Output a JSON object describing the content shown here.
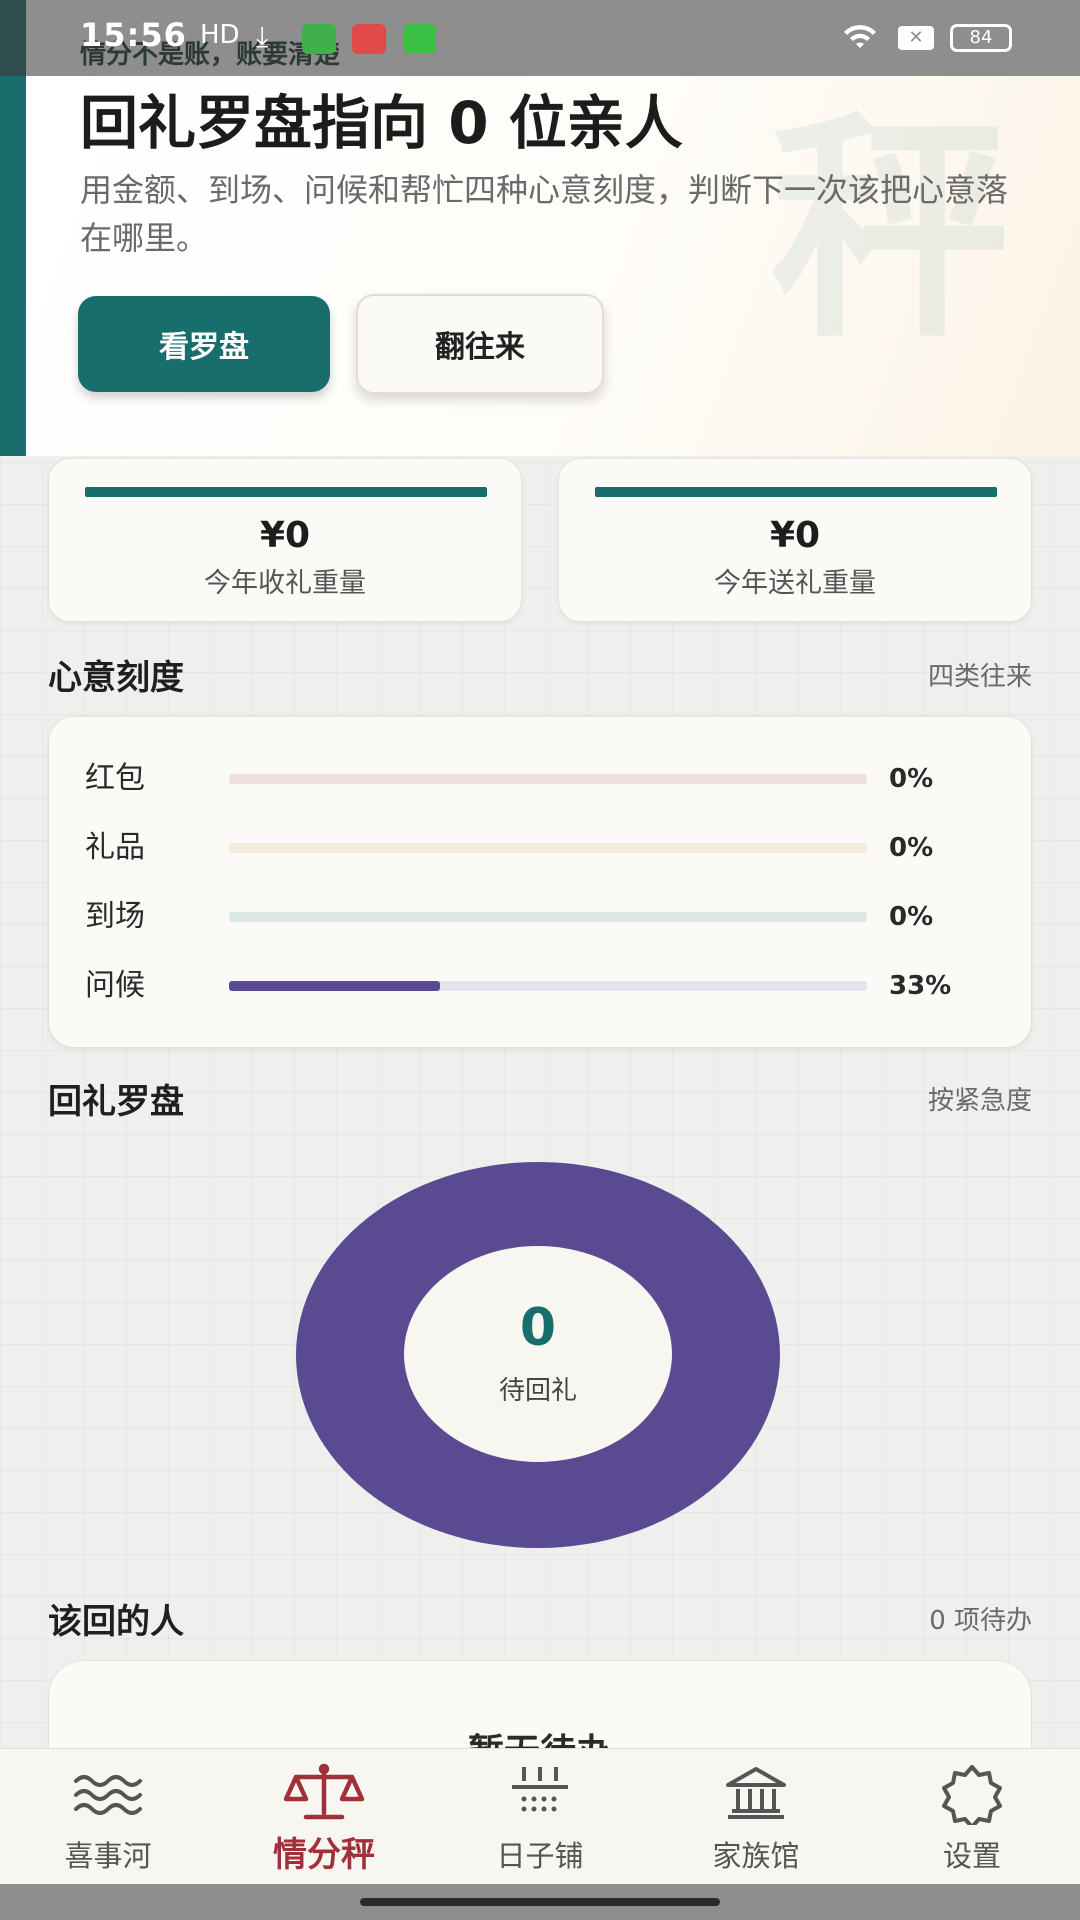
{
  "status_bar": {
    "time": "15:56",
    "behind_text": "情分不是账，账要清楚",
    "battery": "84"
  },
  "hero": {
    "watermark": "秤",
    "title": "回礼罗盘指向 0 位亲人",
    "subtitle": "用金额、到场、问候和帮忙四种心意刻度，判断下一次该把心意落在哪里。",
    "primary_button": "看罗盘",
    "secondary_button": "翻往来"
  },
  "stats": [
    {
      "value": "¥0",
      "label": "今年收礼重量"
    },
    {
      "value": "¥0",
      "label": "今年送礼重量"
    }
  ],
  "scale_section": {
    "title": "心意刻度",
    "note": "四类往来",
    "rows": [
      {
        "label": "红包",
        "pct_text": "0%",
        "fraction": 0.0,
        "track_color": "#efdfe1",
        "fill_color": "#c9707e"
      },
      {
        "label": "礼品",
        "pct_text": "0%",
        "fraction": 0.0,
        "track_color": "#f3ecdc",
        "fill_color": "#d9b46a"
      },
      {
        "label": "到场",
        "pct_text": "0%",
        "fraction": 0.0,
        "track_color": "#dde7e3",
        "fill_color": "#176e6c"
      },
      {
        "label": "问候",
        "pct_text": "33%",
        "fraction": 0.33,
        "track_color": "#e6e3ec",
        "fill_color": "#5a4a92"
      }
    ]
  },
  "compass_section": {
    "title": "回礼罗盘",
    "note": "按紧急度",
    "center_value": "0",
    "center_label": "待回礼",
    "ring_color": "#5a4a92"
  },
  "pending_section": {
    "title": "该回的人",
    "note": "0 项待办",
    "empty_text": "暂无待办"
  },
  "bottom_nav": [
    {
      "label": "喜事河",
      "icon": "river-waves-icon",
      "active": false
    },
    {
      "label": "情分秤",
      "icon": "balance-scale-icon",
      "active": true
    },
    {
      "label": "日子铺",
      "icon": "calendar-grid-icon",
      "active": false
    },
    {
      "label": "家族馆",
      "icon": "temple-hall-icon",
      "active": false
    },
    {
      "label": "设置",
      "icon": "gear-icon",
      "active": false
    }
  ],
  "colors": {
    "brand": "#176e6c",
    "active_nav": "#a2303a",
    "compass": "#5a4a92"
  }
}
